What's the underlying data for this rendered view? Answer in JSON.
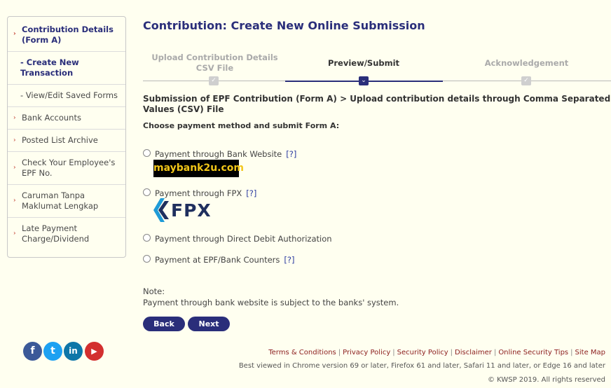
{
  "page_title": "Contribution: Create New Online Submission",
  "sidebar": {
    "items": [
      {
        "label": "Contribution Details (Form A)"
      },
      {
        "label": "- Create New Transaction"
      },
      {
        "label": "- View/Edit Saved Forms"
      },
      {
        "label": "Bank Accounts"
      },
      {
        "label": "Posted List Archive"
      },
      {
        "label": "Check Your Employee's EPF No."
      },
      {
        "label": "Caruman Tanpa Maklumat Lengkap"
      },
      {
        "label": "Late Payment Charge/Dividend"
      }
    ]
  },
  "stepper": {
    "steps": [
      {
        "label": "Upload Contribution Details CSV File",
        "state": "completed"
      },
      {
        "label": "Preview/Submit",
        "state": "active"
      },
      {
        "label": "Acknowledgement",
        "state": "pending"
      }
    ]
  },
  "section_title": "Submission of EPF Contribution (Form A) > Upload contribution details through Comma Separated Values (CSV) File",
  "choose_label": "Choose payment method and submit Form A:",
  "payment_options": [
    {
      "label": "Payment through Bank Website",
      "help": "[?]",
      "logo": "maybank2u.com"
    },
    {
      "label": "Payment through FPX",
      "help": "[?]",
      "logo": "FPX"
    },
    {
      "label": "Payment through Direct Debit Authorization"
    },
    {
      "label": "Payment at EPF/Bank Counters",
      "help": "[?]"
    }
  ],
  "note": {
    "label": "Note:",
    "text": "Payment through bank website is subject to the banks' system."
  },
  "buttons": {
    "back": "Back",
    "next": "Next"
  },
  "social": [
    {
      "icon": "facebook-icon",
      "glyph": "f",
      "color": "#3b5998"
    },
    {
      "icon": "twitter-icon",
      "glyph": "t",
      "color": "#1da1f2"
    },
    {
      "icon": "linkedin-icon",
      "glyph": "in",
      "color": "#0e76a8"
    },
    {
      "icon": "youtube-icon",
      "glyph": "▶",
      "color": "#d32f2f"
    }
  ],
  "footer": {
    "links": [
      "Terms & Conditions",
      "Privacy Policy",
      "Security Policy",
      "Disclaimer",
      "Online Security Tips",
      "Site Map"
    ],
    "browser_note": "Best viewed in Chrome version 69 or later, Firefox 61 and later, Safari 11 and later, or Edge 16 and later",
    "copyright": "© KWSP 2019. All rights reserved"
  },
  "colors": {
    "brand": "#2a2e7a",
    "accent_arrow": "#c0392b",
    "footer_link": "#8b1d1d"
  }
}
